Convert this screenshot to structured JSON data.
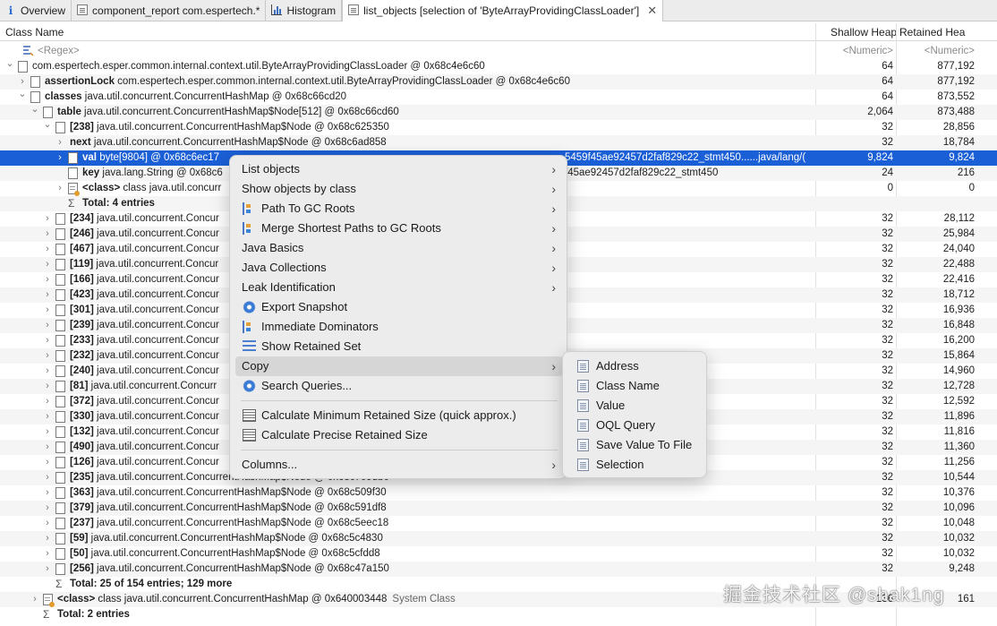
{
  "tabs": [
    {
      "label": "Overview",
      "icon": "info-icon"
    },
    {
      "label": "component_report com.espertech.*",
      "icon": "report-icon"
    },
    {
      "label": "Histogram",
      "icon": "histogram-icon"
    },
    {
      "label": "list_objects [selection of 'ByteArrayProvidingClassLoader']",
      "icon": "list-objects-icon",
      "active": true,
      "close": "✕"
    }
  ],
  "header": {
    "class_name": "Class Name",
    "shallow_heap": "Shallow Heap",
    "retained_heap": "Retained Hea"
  },
  "filter": {
    "regex": "<Regex>",
    "numeric1": "<Numeric>",
    "numeric2": "<Numeric>"
  },
  "rows": [
    {
      "indent": 0,
      "twisty": "v",
      "icon": "object",
      "bold": "",
      "text": "com.espertech.esper.common.internal.context.util.ByteArrayProvidingClassLoader @ 0x68c4e6c60",
      "shallow": "64",
      "retained": "877,192"
    },
    {
      "indent": 1,
      "twisty": ">",
      "icon": "object",
      "bold": "assertionLock",
      "text": " com.espertech.esper.common.internal.context.util.ByteArrayProvidingClassLoader @ 0x68c4e6c60",
      "shallow": "64",
      "retained": "877,192"
    },
    {
      "indent": 1,
      "twisty": "v",
      "icon": "object",
      "bold": "classes",
      "text": " java.util.concurrent.ConcurrentHashMap @ 0x68c66cd20",
      "shallow": "64",
      "retained": "873,552"
    },
    {
      "indent": 2,
      "twisty": "v",
      "icon": "object",
      "bold": "table",
      "text": " java.util.concurrent.ConcurrentHashMap$Node[512] @ 0x68c66cd60",
      "shallow": "2,064",
      "retained": "873,488"
    },
    {
      "indent": 3,
      "twisty": "v",
      "icon": "object",
      "bold": "[238]",
      "text": " java.util.concurrent.ConcurrentHashMap$Node @ 0x68c625350",
      "shallow": "32",
      "retained": "28,856"
    },
    {
      "indent": 4,
      "twisty": ">",
      "icon": "none",
      "bold": "next",
      "text": " java.util.concurrent.ConcurrentHashMap$Node @ 0x68c6ad858",
      "shallow": "32",
      "retained": "18,784"
    },
    {
      "indent": 4,
      "twisty": ">",
      "icon": "object",
      "bold": "val",
      "text": " byte[9804] @ 0x68c6ec17",
      "tail": "5459f45ae92457d2faf829c22_stmt450......java/lang/(",
      "shallow": "9,824",
      "retained": "9,824",
      "selected": true
    },
    {
      "indent": 4,
      "twisty": "",
      "icon": "object",
      "bold": "key",
      "text": " java.lang.String @ 0x68c6",
      "tail": "f45ae92457d2faf829c22_stmt450",
      "shallow": "24",
      "retained": "216"
    },
    {
      "indent": 4,
      "twisty": ">",
      "icon": "class",
      "bold": "<class>",
      "text": " class java.util.concurr",
      "shallow": "0",
      "retained": "0"
    },
    {
      "indent": 4,
      "twisty": "",
      "icon": "sum",
      "bold": "Total: 4 entries",
      "text": "",
      "shallow": "",
      "retained": ""
    },
    {
      "indent": 3,
      "twisty": ">",
      "icon": "object",
      "bold": "[234]",
      "text": " java.util.concurrent.Concur",
      "shallow": "32",
      "retained": "28,112"
    },
    {
      "indent": 3,
      "twisty": ">",
      "icon": "object",
      "bold": "[246]",
      "text": " java.util.concurrent.Concur",
      "shallow": "32",
      "retained": "25,984"
    },
    {
      "indent": 3,
      "twisty": ">",
      "icon": "object",
      "bold": "[467]",
      "text": " java.util.concurrent.Concur",
      "shallow": "32",
      "retained": "24,040"
    },
    {
      "indent": 3,
      "twisty": ">",
      "icon": "object",
      "bold": "[119]",
      "text": " java.util.concurrent.Concur",
      "shallow": "32",
      "retained": "22,488"
    },
    {
      "indent": 3,
      "twisty": ">",
      "icon": "object",
      "bold": "[166]",
      "text": " java.util.concurrent.Concur",
      "shallow": "32",
      "retained": "22,416"
    },
    {
      "indent": 3,
      "twisty": ">",
      "icon": "object",
      "bold": "[423]",
      "text": " java.util.concurrent.Concur",
      "shallow": "32",
      "retained": "18,712"
    },
    {
      "indent": 3,
      "twisty": ">",
      "icon": "object",
      "bold": "[301]",
      "text": " java.util.concurrent.Concur",
      "shallow": "32",
      "retained": "16,936"
    },
    {
      "indent": 3,
      "twisty": ">",
      "icon": "object",
      "bold": "[239]",
      "text": " java.util.concurrent.Concur",
      "shallow": "32",
      "retained": "16,848"
    },
    {
      "indent": 3,
      "twisty": ">",
      "icon": "object",
      "bold": "[233]",
      "text": " java.util.concurrent.Concur",
      "shallow": "32",
      "retained": "16,200"
    },
    {
      "indent": 3,
      "twisty": ">",
      "icon": "object",
      "bold": "[232]",
      "text": " java.util.concurrent.Concur",
      "shallow": "32",
      "retained": "15,864"
    },
    {
      "indent": 3,
      "twisty": ">",
      "icon": "object",
      "bold": "[240]",
      "text": " java.util.concurrent.Concur",
      "shallow": "32",
      "retained": "14,960"
    },
    {
      "indent": 3,
      "twisty": ">",
      "icon": "object",
      "bold": "[81]",
      "text": " java.util.concurrent.Concurr",
      "shallow": "32",
      "retained": "12,728"
    },
    {
      "indent": 3,
      "twisty": ">",
      "icon": "object",
      "bold": "[372]",
      "text": " java.util.concurrent.Concur",
      "shallow": "32",
      "retained": "12,592"
    },
    {
      "indent": 3,
      "twisty": ">",
      "icon": "object",
      "bold": "[330]",
      "text": " java.util.concurrent.Concur",
      "shallow": "32",
      "retained": "11,896"
    },
    {
      "indent": 3,
      "twisty": ">",
      "icon": "object",
      "bold": "[132]",
      "text": " java.util.concurrent.Concur",
      "shallow": "32",
      "retained": "11,816"
    },
    {
      "indent": 3,
      "twisty": ">",
      "icon": "object",
      "bold": "[490]",
      "text": " java.util.concurrent.Concur",
      "shallow": "32",
      "retained": "11,360"
    },
    {
      "indent": 3,
      "twisty": ">",
      "icon": "object",
      "bold": "[126]",
      "text": " java.util.concurrent.Concur",
      "shallow": "32",
      "retained": "11,256"
    },
    {
      "indent": 3,
      "twisty": ">",
      "icon": "object",
      "bold": "[235]",
      "text": " java.util.concurrent.ConcurrentHashMap$Node @ 0x68c709db0",
      "shallow": "32",
      "retained": "10,544"
    },
    {
      "indent": 3,
      "twisty": ">",
      "icon": "object",
      "bold": "[363]",
      "text": " java.util.concurrent.ConcurrentHashMap$Node @ 0x68c509f30",
      "shallow": "32",
      "retained": "10,376"
    },
    {
      "indent": 3,
      "twisty": ">",
      "icon": "object",
      "bold": "[379]",
      "text": " java.util.concurrent.ConcurrentHashMap$Node @ 0x68c591df8",
      "shallow": "32",
      "retained": "10,096"
    },
    {
      "indent": 3,
      "twisty": ">",
      "icon": "object",
      "bold": "[237]",
      "text": " java.util.concurrent.ConcurrentHashMap$Node @ 0x68c5eec18",
      "shallow": "32",
      "retained": "10,048"
    },
    {
      "indent": 3,
      "twisty": ">",
      "icon": "object",
      "bold": "[59]",
      "text": " java.util.concurrent.ConcurrentHashMap$Node @ 0x68c5c4830",
      "shallow": "32",
      "retained": "10,032"
    },
    {
      "indent": 3,
      "twisty": ">",
      "icon": "object",
      "bold": "[50]",
      "text": " java.util.concurrent.ConcurrentHashMap$Node @ 0x68c5cfdd8",
      "shallow": "32",
      "retained": "10,032"
    },
    {
      "indent": 3,
      "twisty": ">",
      "icon": "object",
      "bold": "[256]",
      "text": " java.util.concurrent.ConcurrentHashMap$Node @ 0x68c47a150",
      "shallow": "32",
      "retained": "9,248"
    },
    {
      "indent": 3,
      "twisty": "",
      "icon": "sum-arrow",
      "bold": "Total: 25 of 154 entries; 129 more",
      "text": "",
      "shallow": "",
      "retained": ""
    },
    {
      "indent": 2,
      "twisty": ">",
      "icon": "class",
      "bold": "<class>",
      "text": " class java.util.concurrent.ConcurrentHashMap @ 0x640003448",
      "suffix": "System Class",
      "shallow": "136",
      "retained": "161"
    },
    {
      "indent": 2,
      "twisty": "",
      "icon": "sum",
      "bold": "Total: 2 entries",
      "text": "",
      "shallow": "",
      "retained": ""
    }
  ],
  "context_menu": [
    {
      "label": "List objects",
      "submenu": true
    },
    {
      "label": "Show objects by class",
      "submenu": true
    },
    {
      "label": "Path To GC Roots",
      "icon": "path-gc-icon",
      "submenu": true
    },
    {
      "label": "Merge Shortest Paths to GC Roots",
      "icon": "merge-paths-icon",
      "submenu": true
    },
    {
      "label": "Java Basics",
      "submenu": true
    },
    {
      "label": "Java Collections",
      "submenu": true
    },
    {
      "label": "Leak Identification",
      "submenu": true
    },
    {
      "label": "Export Snapshot",
      "icon": "export-icon"
    },
    {
      "label": "Immediate Dominators",
      "icon": "dominators-icon"
    },
    {
      "label": "Show Retained Set",
      "icon": "retained-set-icon"
    },
    {
      "label": "Copy",
      "submenu": true,
      "highlighted": true
    },
    {
      "label": "Search Queries...",
      "icon": "search-queries-icon"
    },
    {
      "separator": true
    },
    {
      "label": "Calculate Minimum Retained Size (quick approx.)",
      "icon": "calculator-icon"
    },
    {
      "label": "Calculate Precise Retained Size",
      "icon": "calculator-icon"
    },
    {
      "separator": true
    },
    {
      "label": "Columns...",
      "submenu": true
    }
  ],
  "copy_submenu": [
    "Address",
    "Class Name",
    "Value",
    "OQL Query",
    "Save Value To File",
    "Selection"
  ],
  "watermark": "掘金技术社区 @shak1ng"
}
